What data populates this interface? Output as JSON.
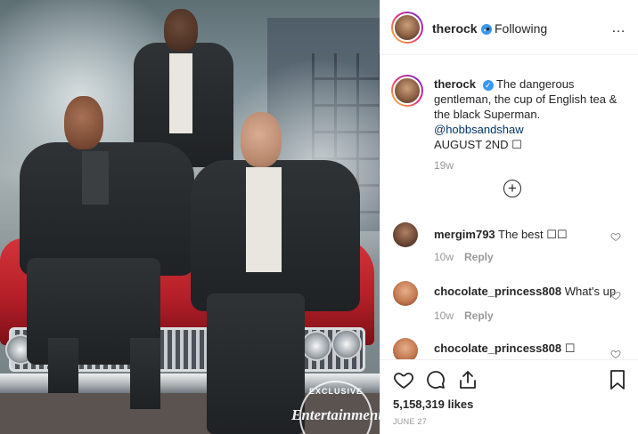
{
  "post": {
    "image_alt": "Three men in dark suits posing on a red car amid smoke",
    "badge_exclusive": "EXCLUSIVE",
    "badge_brand": "Entertainment"
  },
  "header": {
    "username": "therock",
    "verified_glyph": "✓",
    "separator": "•",
    "follow_status": "Following",
    "more_glyph": "…"
  },
  "caption": {
    "username": "therock",
    "verified_glyph": "✓",
    "text": "The dangerous gentleman, the cup of English tea & the black Superman.",
    "mention": "@hobbsandshaw",
    "date_line": "AUGUST 2ND ☐",
    "time": "19w"
  },
  "load_more_glyph": "+",
  "comments": [
    {
      "username": "mergim793",
      "text": "The best ☐☐",
      "time": "10w",
      "reply_label": "Reply"
    },
    {
      "username": "chocolate_princess808",
      "text": "What's up",
      "time": "10w",
      "reply_label": "Reply"
    },
    {
      "username": "chocolate_princess808",
      "text": "☐",
      "time": "",
      "reply_label": ""
    }
  ],
  "actions": {
    "likes": "5,158,319 likes",
    "date": "JUNE 27"
  },
  "colors": {
    "link": "#003569",
    "verified": "#3897f0",
    "muted": "#999999",
    "text": "#262626"
  },
  "icons": [
    "heart-icon",
    "comment-icon",
    "share-icon",
    "bookmark-icon",
    "more-icon",
    "plus-circle-icon",
    "verified-icon"
  ]
}
